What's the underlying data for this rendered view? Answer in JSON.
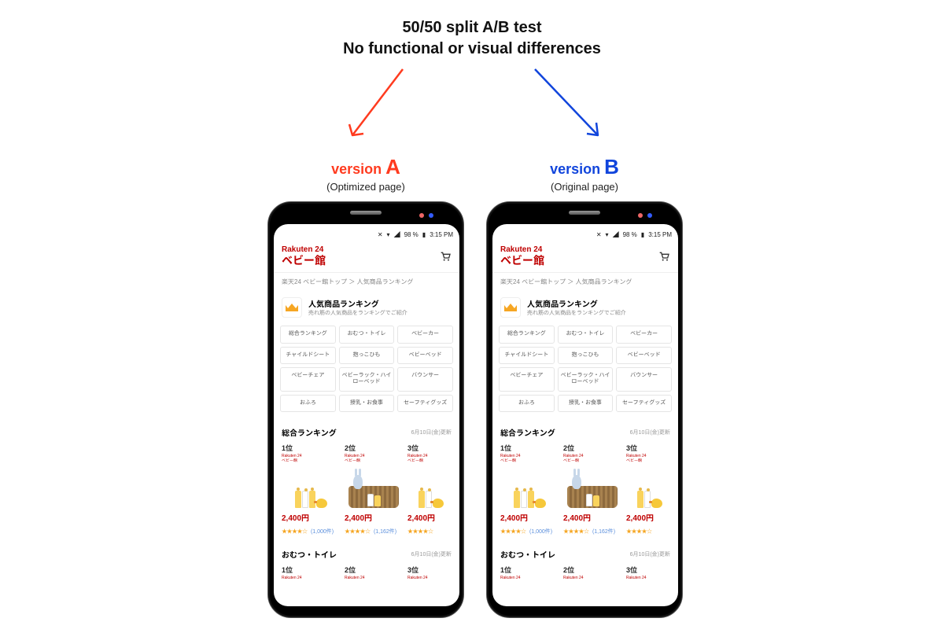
{
  "heading": {
    "line1": "50/50 split A/B test",
    "line2": "No functional or visual differences"
  },
  "labels": {
    "a_prefix": "version ",
    "a_letter": "A",
    "a_sub": "(Optimized page)",
    "b_prefix": "version ",
    "b_letter": "B",
    "b_sub": "(Original page)"
  },
  "colors": {
    "a": "#ff3b1f",
    "b": "#1145dc"
  },
  "status": {
    "battery": "98 %",
    "time": "3:15 PM"
  },
  "brand": {
    "line1": "Rakuten 24",
    "line2": "ベビー館"
  },
  "breadcrumb": "楽天24 ベビー館トップ ＞ 人気商品ランキング",
  "ranking_header": {
    "title": "人気商品ランキング",
    "sub": "売れ筋の人気商品をランキングでご紹介"
  },
  "categories": [
    "総合ランキング",
    "おむつ・トイレ",
    "ベビーカー",
    "チャイルドシート",
    "抱っこひも",
    "ベビーベッド",
    "ベビーチェア",
    "ベビーラック・ハイローベッド",
    "バウンサー",
    "おふろ",
    "授乳・お食事",
    "セーフティグッズ"
  ],
  "section1": {
    "label": "総合ランキング",
    "date": "6月10日(金)更新"
  },
  "ranks": [
    "1位",
    "2位",
    "3位"
  ],
  "mini_brand": {
    "l1": "Rakuten 24",
    "l2": "ベビー館"
  },
  "products": [
    {
      "price": "2,400円",
      "stars": "★★★★☆",
      "reviews": "(1,000件)"
    },
    {
      "price": "2,400円",
      "stars": "★★★★☆",
      "reviews": "(1,162件)"
    },
    {
      "price": "2,400円",
      "stars": "★★★★☆",
      "reviews": ""
    }
  ],
  "section2": {
    "label": "おむつ・トイレ",
    "date": "6月10日(金)更新"
  },
  "ranks2": [
    "1位",
    "2位",
    "3位"
  ],
  "mini2": "Rakuten 24"
}
